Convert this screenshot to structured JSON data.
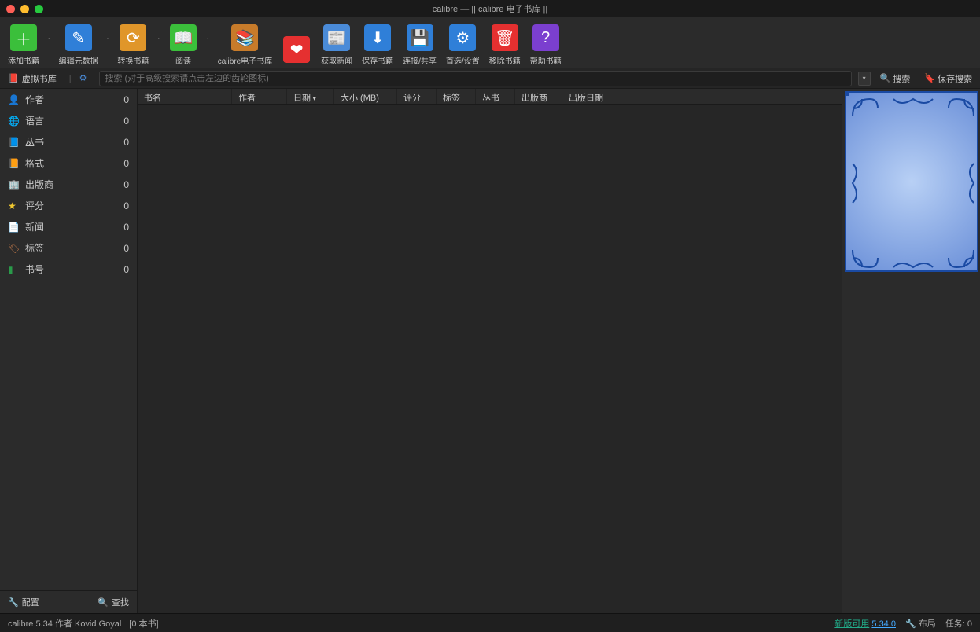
{
  "titlebar": {
    "title": "calibre — || calibre 电子书库 ||"
  },
  "toolbar": [
    {
      "id": "add",
      "label": "添加书籍",
      "color": "#3bbf3b",
      "glyph": "＋"
    },
    {
      "id": "edit",
      "label": "编辑元数据",
      "color": "#2f7fd8",
      "glyph": "✎"
    },
    {
      "id": "convert",
      "label": "转换书籍",
      "color": "#e0962a",
      "glyph": "⟳"
    },
    {
      "id": "view",
      "label": "阅读",
      "color": "#3bbf3b",
      "glyph": "📖"
    },
    {
      "id": "library",
      "label": "calibre电子书库",
      "color": "#c77b2a",
      "glyph": "📚"
    },
    {
      "id": "donate",
      "label": "",
      "color": "#e53030",
      "glyph": "❤"
    },
    {
      "id": "fetch",
      "label": "获取新闻",
      "color": "#4a8bd8",
      "glyph": "📰"
    },
    {
      "id": "save",
      "label": "保存书籍",
      "color": "#2f7fd8",
      "glyph": "⬇"
    },
    {
      "id": "connect",
      "label": "连接/共享",
      "color": "#2f7fd8",
      "glyph": "💾"
    },
    {
      "id": "prefs",
      "label": "首选/设置",
      "color": "#2f7fd8",
      "glyph": "⚙"
    },
    {
      "id": "remove",
      "label": "移除书籍",
      "color": "#e53030",
      "glyph": "🗑"
    },
    {
      "id": "help",
      "label": "帮助书籍",
      "color": "#7b3fcf",
      "glyph": "?"
    }
  ],
  "searchbar": {
    "virtual_library": "虚拟书库",
    "placeholder": "搜索 (对于高级搜索请点击左边的齿轮图标)",
    "search_btn": "搜索",
    "saved_btn": "保存搜索"
  },
  "sidebar": {
    "items": [
      {
        "icon": "author",
        "color": "#3a8de0",
        "label": "作者",
        "count": 0
      },
      {
        "icon": "lang",
        "color": "#5a6ed0",
        "label": "语言",
        "count": 0
      },
      {
        "icon": "series",
        "color": "#2a95c5",
        "label": "丛书",
        "count": 0
      },
      {
        "icon": "format",
        "color": "#c78a3a",
        "label": "格式",
        "count": 0
      },
      {
        "icon": "pub",
        "color": "#2a7fbf",
        "label": "出版商",
        "count": 0
      },
      {
        "icon": "rating",
        "color": "#f0c830",
        "label": "评分",
        "count": 0
      },
      {
        "icon": "news",
        "color": "#aaa",
        "label": "新闻",
        "count": 0
      },
      {
        "icon": "tag",
        "color": "#c77b4a",
        "label": "标签",
        "count": 0
      },
      {
        "icon": "id",
        "color": "#2a9a4a",
        "label": "书号",
        "count": 0
      }
    ],
    "bottom": {
      "config": "配置",
      "find": "查找"
    }
  },
  "columns": [
    {
      "id": "title",
      "label": "书名",
      "w": 120
    },
    {
      "id": "author",
      "label": "作者",
      "w": 70
    },
    {
      "id": "date",
      "label": "日期",
      "w": 60,
      "sort": true
    },
    {
      "id": "size",
      "label": "大小 (MB)",
      "w": 80
    },
    {
      "id": "rating",
      "label": "评分",
      "w": 50
    },
    {
      "id": "tags",
      "label": "标签",
      "w": 50
    },
    {
      "id": "series",
      "label": "丛书",
      "w": 50
    },
    {
      "id": "publisher",
      "label": "出版商",
      "w": 60
    },
    {
      "id": "pubdate",
      "label": "出版日期",
      "w": 70
    }
  ],
  "statusbar": {
    "version_text": "calibre 5.34 作者 Kovid Goyal",
    "book_count": "[0 本书]",
    "update_label": "新版可用",
    "update_ver": "5.34.0",
    "layout": "布局",
    "jobs_label": "任务:",
    "jobs_count": "0"
  }
}
